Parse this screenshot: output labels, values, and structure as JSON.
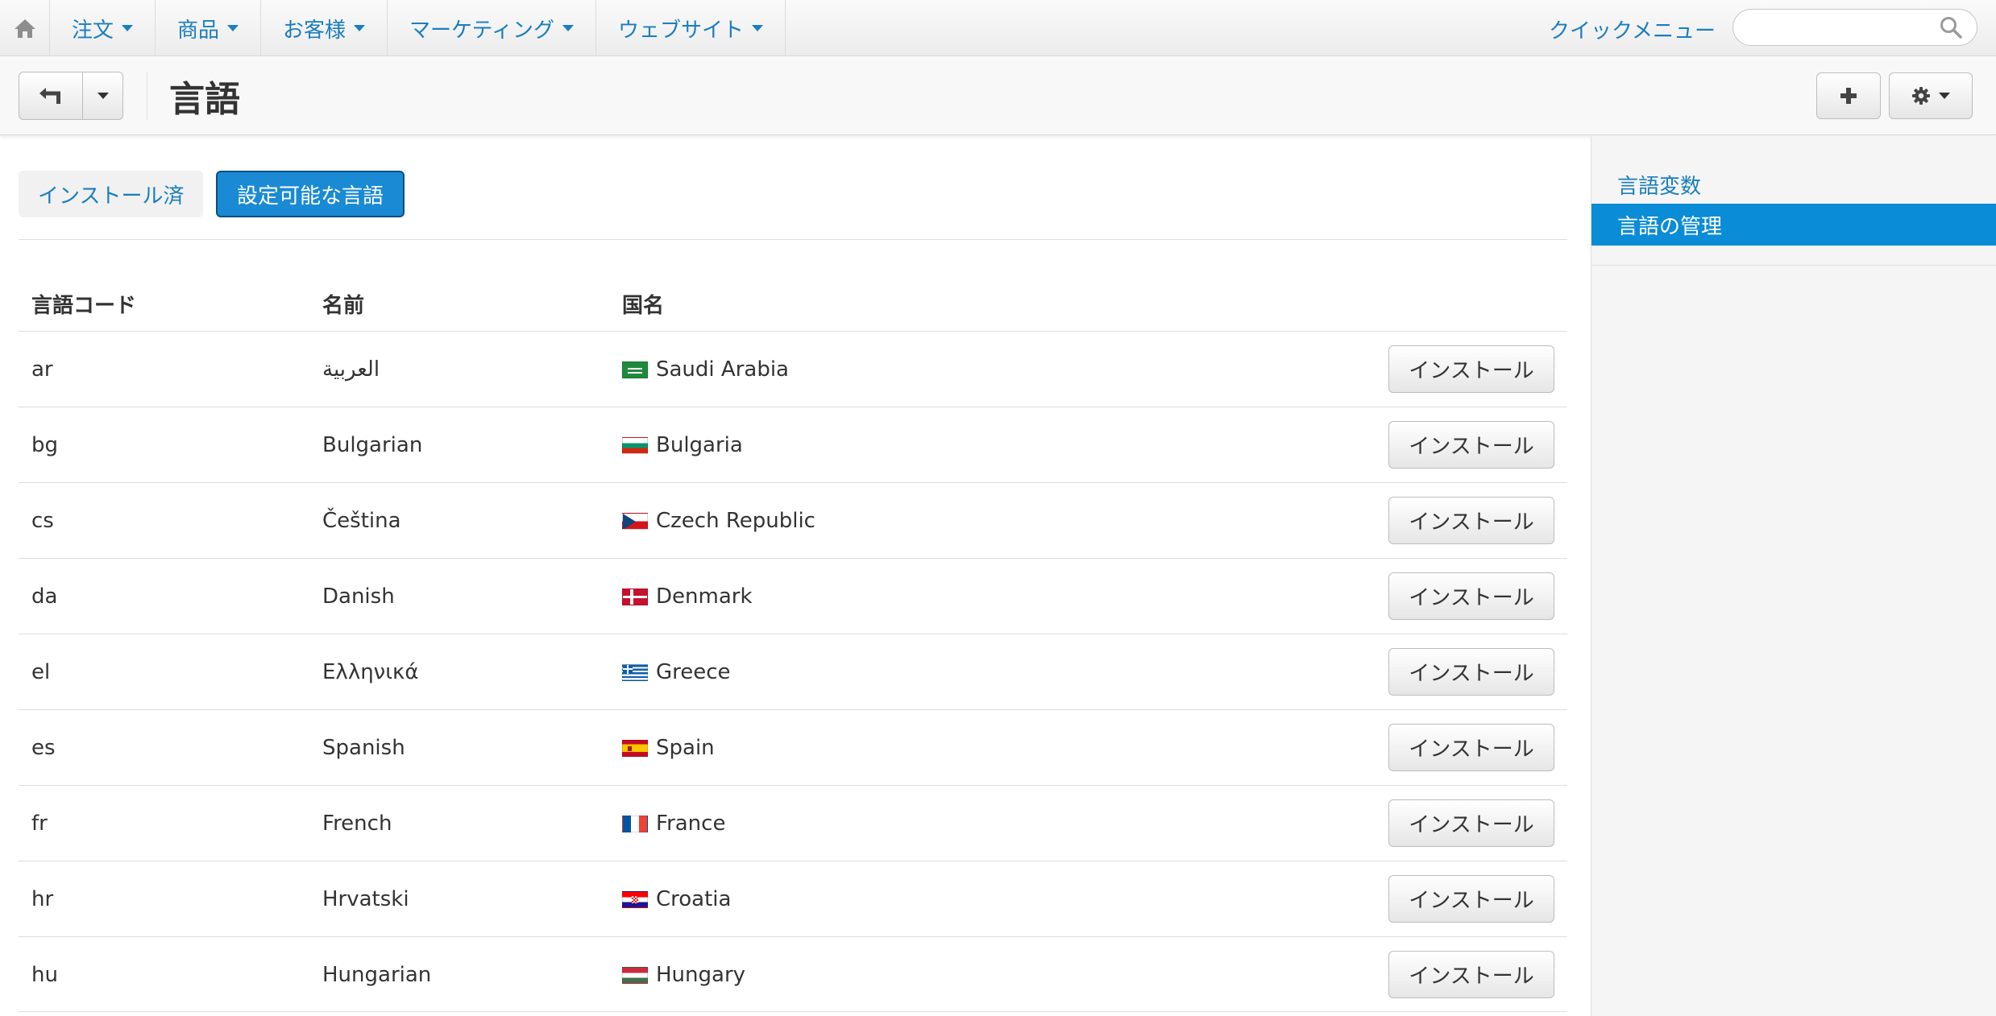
{
  "nav": {
    "items": [
      {
        "label": "注文"
      },
      {
        "label": "商品"
      },
      {
        "label": "お客様"
      },
      {
        "label": "マーケティング"
      },
      {
        "label": "ウェブサイト"
      }
    ],
    "quick_menu": "クイックメニュー",
    "search_placeholder": ""
  },
  "header": {
    "title": "言語"
  },
  "tabs": {
    "installed": "インストール済",
    "available": "設定可能な言語"
  },
  "table": {
    "headers": {
      "code": "言語コード",
      "name": "名前",
      "country": "国名"
    },
    "install_label": "インストール",
    "rows": [
      {
        "code": "ar",
        "name": "العربية",
        "country": "Saudi Arabia",
        "flag": "sa"
      },
      {
        "code": "bg",
        "name": "Bulgarian",
        "country": "Bulgaria",
        "flag": "bg"
      },
      {
        "code": "cs",
        "name": "Čeština",
        "country": "Czech Republic",
        "flag": "cz"
      },
      {
        "code": "da",
        "name": "Danish",
        "country": "Denmark",
        "flag": "dk"
      },
      {
        "code": "el",
        "name": "Ελληνικά",
        "country": "Greece",
        "flag": "gr"
      },
      {
        "code": "es",
        "name": "Spanish",
        "country": "Spain",
        "flag": "es"
      },
      {
        "code": "fr",
        "name": "French",
        "country": "France",
        "flag": "fr"
      },
      {
        "code": "hr",
        "name": "Hrvatski",
        "country": "Croatia",
        "flag": "hr"
      },
      {
        "code": "hu",
        "name": "Hungarian",
        "country": "Hungary",
        "flag": "hu"
      }
    ]
  },
  "sidebar": {
    "items": [
      {
        "label": "言語変数"
      },
      {
        "label": "言語の管理"
      }
    ]
  },
  "colors": {
    "link": "#1a7ec0",
    "active": "#0b8cd7"
  }
}
